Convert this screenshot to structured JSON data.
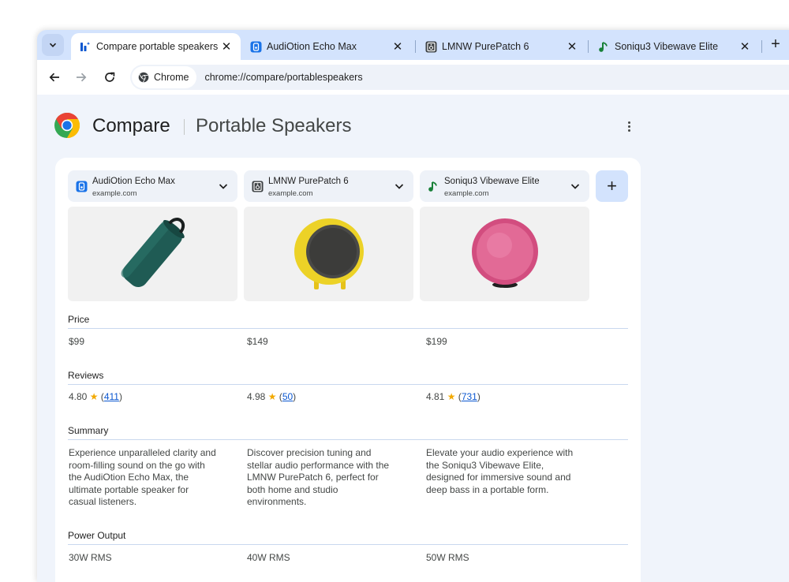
{
  "tabs": [
    {
      "label": "Compare portable speakers",
      "icon": "compare-icon",
      "active": true
    },
    {
      "label": "AudiOtion Echo Max",
      "icon": "audiotion-favicon-icon",
      "active": false
    },
    {
      "label": "LMNW PurePatch 6",
      "icon": "lmnw-favicon-icon",
      "active": false
    },
    {
      "label": "Soniqu3 Vibewave Elite",
      "icon": "music-note-favicon-icon",
      "active": false
    }
  ],
  "toolbar": {
    "chip_label": "Chrome",
    "url": "chrome://compare/portablespeakers"
  },
  "header": {
    "title": "Compare",
    "subtitle": "Portable Speakers"
  },
  "products": [
    {
      "name": "AudiOtion Echo Max",
      "site": "example.com",
      "price": "$99",
      "rating": "4.80",
      "review_count": "411",
      "summary": "Experience unparalleled clarity and room-filling sound on the go with the AudiOtion Echo Max, the ultimate portable speaker for casual listeners.",
      "power": "30W RMS",
      "image": "green-cylinder-speaker"
    },
    {
      "name": "LMNW PurePatch 6",
      "site": "example.com",
      "price": "$149",
      "rating": "4.98",
      "review_count": "50",
      "summary": "Discover precision tuning and stellar audio performance with the LMNW PurePatch 6, perfect for both home and studio environments.",
      "power": "40W RMS",
      "image": "yellow-round-speaker"
    },
    {
      "name": "Soniqu3 Vibewave Elite",
      "site": "example.com",
      "price": "$199",
      "rating": "4.81",
      "review_count": "731",
      "summary": "Elevate your audio experience with the Soniqu3 Vibewave Elite, designed for immersive sound and deep bass in a portable form.",
      "power": "50W RMS",
      "image": "pink-sphere-speaker"
    }
  ],
  "sections": {
    "price": "Price",
    "reviews": "Reviews",
    "summary": "Summary",
    "power": "Power Output"
  },
  "colors": {
    "accent": "#0b57d0",
    "star": "#f2a900",
    "tab_strip": "#d3e3fd",
    "add_button": "#d3e3fd"
  }
}
